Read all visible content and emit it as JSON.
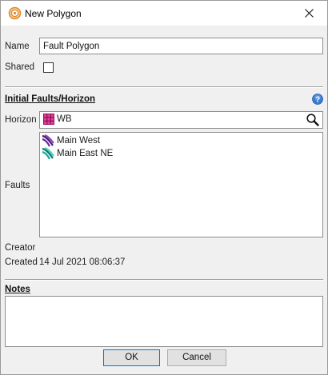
{
  "window": {
    "title": "New Polygon"
  },
  "form": {
    "name_label": "Name",
    "name_value": "Fault Polygon",
    "shared_label": "Shared",
    "shared_checked": false
  },
  "initial": {
    "section_title": "Initial Faults/Horizon",
    "horizon_label": "Horizon",
    "horizon_value": "WB",
    "faults_label": "Faults",
    "faults": [
      {
        "label": "Main West",
        "icon": "fault-surface-purple-icon",
        "color": "#6a2a9c"
      },
      {
        "label": "Main East NE",
        "icon": "fault-surface-teal-icon",
        "color": "#1aa89a"
      }
    ]
  },
  "meta": {
    "creator_label": "Creator",
    "created_label": "Created",
    "created_value": "14 Jul 2021 08:06:37"
  },
  "notes": {
    "section_title": "Notes",
    "value": ""
  },
  "buttons": {
    "ok_label": "OK",
    "cancel_label": "Cancel"
  },
  "colors": {
    "title_icon": "#e0882c",
    "horizon_icon": "#c8197a",
    "help_icon": "#3b7bd4",
    "default_button_border": "#0078d7"
  }
}
